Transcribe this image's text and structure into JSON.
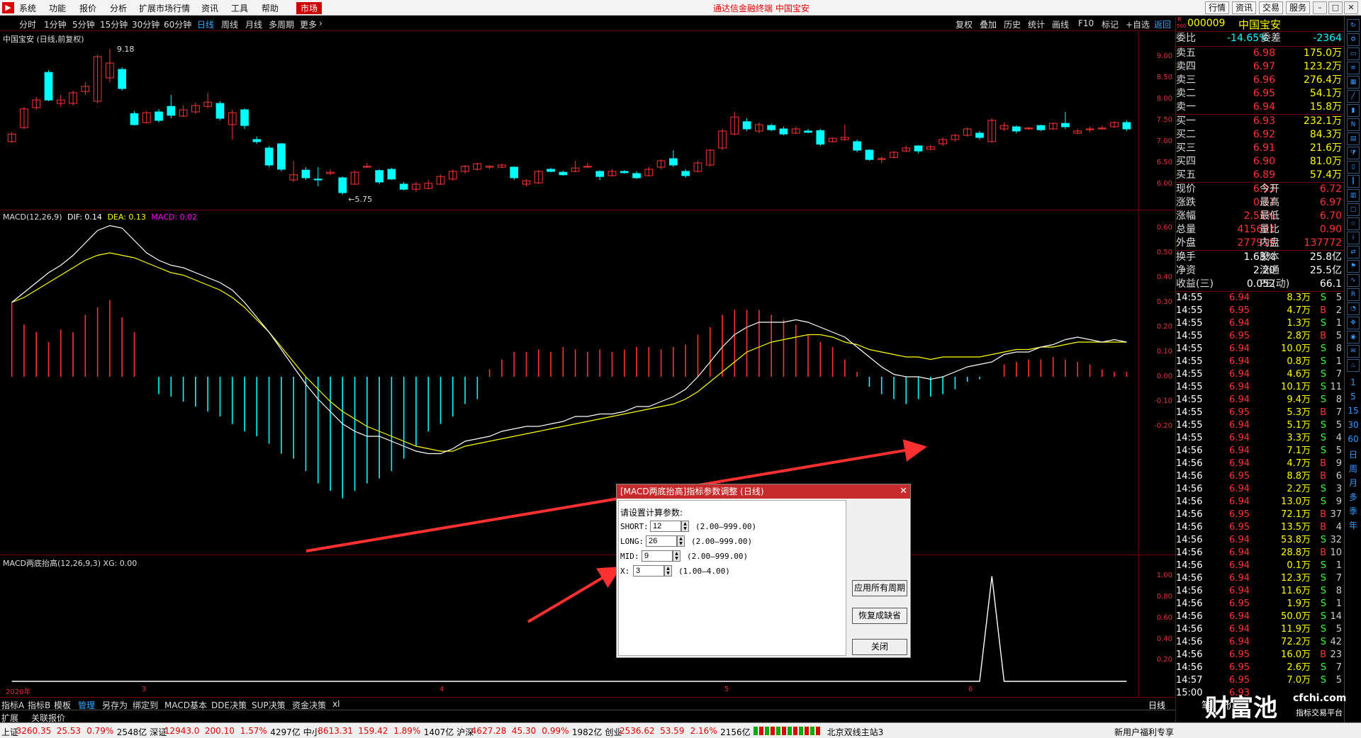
{
  "menubar": {
    "items": [
      "系统",
      "功能",
      "报价",
      "分析",
      "扩展市场行情",
      "资讯",
      "工具",
      "帮助"
    ],
    "market": "市场",
    "title": "通达信金融终端  中国宝安",
    "right_buttons": [
      "行情",
      "资讯",
      "交易",
      "服务"
    ]
  },
  "periods": [
    "分时",
    "1分钟",
    "5分钟",
    "15分钟",
    "30分钟",
    "60分钟",
    "日线",
    "周线",
    "月线",
    "多周期",
    "更多"
  ],
  "active_period": "日线",
  "chart_tools": [
    "复权",
    "叠加",
    "历史",
    "统计",
    "画线",
    "F10",
    "标记",
    "+自选",
    "返回"
  ],
  "main": {
    "title": "中国宝安 (日线,前复权)",
    "high_label": "9.18",
    "low_label": "5.75",
    "y_ticks": [
      "9.00",
      "8.50",
      "8.00",
      "7.50",
      "7.00",
      "6.50",
      "6.00"
    ]
  },
  "macd": {
    "name": "MACD(12,26,9)",
    "dif_label": "DIF: 0.14",
    "dea_label": "DEA: 0.13",
    "macd_label": "MACD: 0.02",
    "y_ticks": [
      "0.60",
      "0.50",
      "0.40",
      "0.30",
      "0.20",
      "0.10",
      "0.00",
      "-0.10",
      "-0.20"
    ]
  },
  "xg": {
    "title": "MACD两底抬高(12,26,9,3)  XG: 0.00",
    "y_ticks": [
      "1.00",
      "0.80",
      "0.60",
      "0.40",
      "0.20"
    ]
  },
  "x_labels": [
    "2020年",
    "3",
    "4",
    "5",
    "6"
  ],
  "bottom_tabs": [
    "指标A",
    "指标B",
    "模板",
    "管理",
    "另存为",
    "绑定到",
    "MACD基本",
    "DDE决策",
    "SUP决策",
    "资金决策",
    "xl"
  ],
  "active_tab": "管理",
  "sub_tabs": [
    "扩展",
    "关联报价"
  ],
  "period_badge": "日线",
  "dialog": {
    "title": "[MACD两底抬高]指标参数调整 (日线)",
    "prompt": "请设置计算参数:",
    "params": [
      {
        "name": "SHORT:",
        "value": "12",
        "range": "(2.00—999.00)"
      },
      {
        "name": "LONG:",
        "value": "26",
        "range": "(2.00—999.00)"
      },
      {
        "name": "MID:",
        "value": "9",
        "range": "(2.00—999.00)"
      },
      {
        "name": "X:",
        "value": "3",
        "range": "(1.00—4.00)"
      }
    ],
    "buttons": [
      "应用所有周期",
      "恢复成缺省",
      "关闭"
    ]
  },
  "quote": {
    "code": "000009",
    "name": "中国宝安",
    "badge_r": "R",
    "badge_num": "500",
    "weibi_label": "委比",
    "weibi": "-14.65%",
    "weicha_label": "委差",
    "weicha": "-2364",
    "sell": [
      {
        "label": "卖五",
        "price": "6.98",
        "vol": "175.0万"
      },
      {
        "label": "卖四",
        "price": "6.97",
        "vol": "123.2万"
      },
      {
        "label": "卖三",
        "price": "6.96",
        "vol": "276.4万"
      },
      {
        "label": "卖二",
        "price": "6.95",
        "vol": "54.1万"
      },
      {
        "label": "卖一",
        "price": "6.94",
        "vol": "15.8万"
      }
    ],
    "buy": [
      {
        "label": "买一",
        "price": "6.93",
        "vol": "232.1万"
      },
      {
        "label": "买二",
        "price": "6.92",
        "vol": "84.3万"
      },
      {
        "label": "买三",
        "price": "6.91",
        "vol": "21.6万"
      },
      {
        "label": "买四",
        "price": "6.90",
        "vol": "81.0万"
      },
      {
        "label": "买五",
        "price": "6.89",
        "vol": "57.4万"
      }
    ],
    "stats": [
      {
        "l1": "现价",
        "v1": "6.93",
        "l2": "今开",
        "v2": "6.72"
      },
      {
        "l1": "涨跌",
        "v1": "0.17",
        "l2": "最高",
        "v2": "6.97"
      },
      {
        "l1": "涨幅",
        "v1": "2.51%",
        "l2": "最低",
        "v2": "6.70"
      },
      {
        "l1": "总量",
        "v1": "415691",
        "l2": "量比",
        "v2": "0.90"
      },
      {
        "l1": "外盘",
        "v1": "277919",
        "l2": "内盘",
        "v2": "137772"
      }
    ],
    "stats2": [
      {
        "l1": "换手",
        "v1": "1.63%",
        "l2": "股本",
        "v2": "25.8亿"
      },
      {
        "l1": "净资",
        "v1": "2.20",
        "l2": "流通",
        "v2": "25.5亿"
      },
      {
        "l1": "收益(三)",
        "v1": "0.052",
        "l2": "PE(动)",
        "v2": "66.1"
      }
    ],
    "ticks": [
      [
        "14:55",
        "6.94",
        "8.3万",
        "S",
        "5"
      ],
      [
        "14:55",
        "6.95",
        "4.7万",
        "B",
        "2"
      ],
      [
        "14:55",
        "6.94",
        "1.3万",
        "S",
        "1"
      ],
      [
        "14:55",
        "6.95",
        "2.8万",
        "B",
        "5"
      ],
      [
        "14:55",
        "6.94",
        "10.0万",
        "S",
        "8"
      ],
      [
        "14:55",
        "6.94",
        "0.8万",
        "S",
        "1"
      ],
      [
        "14:55",
        "6.94",
        "4.6万",
        "S",
        "7"
      ],
      [
        "14:55",
        "6.94",
        "10.1万",
        "S",
        "11"
      ],
      [
        "14:55",
        "6.94",
        "9.4万",
        "S",
        "8"
      ],
      [
        "14:55",
        "6.95",
        "5.3万",
        "B",
        "7"
      ],
      [
        "14:55",
        "6.94",
        "5.1万",
        "S",
        "5"
      ],
      [
        "14:55",
        "6.94",
        "3.3万",
        "S",
        "4"
      ],
      [
        "14:56",
        "6.94",
        "7.1万",
        "S",
        "5"
      ],
      [
        "14:56",
        "6.94",
        "4.7万",
        "B",
        "9"
      ],
      [
        "14:56",
        "6.95",
        "8.8万",
        "B",
        "6"
      ],
      [
        "14:56",
        "6.94",
        "2.2万",
        "S",
        "3"
      ],
      [
        "14:56",
        "6.94",
        "13.0万",
        "S",
        "9"
      ],
      [
        "14:56",
        "6.95",
        "72.1万",
        "B",
        "37"
      ],
      [
        "14:56",
        "6.95",
        "13.5万",
        "B",
        "4"
      ],
      [
        "14:56",
        "6.94",
        "53.8万",
        "S",
        "32"
      ],
      [
        "14:56",
        "6.94",
        "28.8万",
        "B",
        "10"
      ],
      [
        "14:56",
        "6.94",
        "0.1万",
        "S",
        "1"
      ],
      [
        "14:56",
        "6.94",
        "12.3万",
        "S",
        "7"
      ],
      [
        "14:56",
        "6.94",
        "11.6万",
        "S",
        "8"
      ],
      [
        "14:56",
        "6.95",
        "1.9万",
        "S",
        "1"
      ],
      [
        "14:56",
        "6.94",
        "50.0万",
        "S",
        "14"
      ],
      [
        "14:56",
        "6.94",
        "11.9万",
        "S",
        "5"
      ],
      [
        "14:56",
        "6.94",
        "72.2万",
        "S",
        "42"
      ],
      [
        "14:56",
        "6.95",
        "16.0万",
        "B",
        "23"
      ],
      [
        "14:56",
        "6.95",
        "2.6万",
        "S",
        "7"
      ],
      [
        "14:57",
        "6.95",
        "7.0万",
        "S",
        "5"
      ],
      [
        "15:00",
        "6.93",
        "",
        "",
        ""
      ]
    ],
    "bottom_labels": [
      "笔",
      "价"
    ]
  },
  "right_icons": [
    "1",
    "5",
    "15",
    "30",
    "60",
    "日",
    "周",
    "月",
    "多",
    "季",
    "年"
  ],
  "watermark": {
    "logo": "财富池",
    "site": "cfchi.com",
    "slogan": "指标交易平台"
  },
  "status": {
    "items": [
      {
        "name": "上证",
        "val": "3260.35",
        "chg": "25.53",
        "pct": "0.79%",
        "amt": "2548亿"
      },
      {
        "name": "深证",
        "val": "12943.0",
        "chg": "200.10",
        "pct": "1.57%",
        "amt": "4297亿"
      },
      {
        "name": "中小",
        "val": "8613.31",
        "chg": "159.42",
        "pct": "1.89%",
        "amt": "1407亿"
      },
      {
        "name": "沪深",
        "val": "4627.28",
        "chg": "45.30",
        "pct": "0.99%",
        "amt": "1982亿"
      },
      {
        "name": "创业",
        "val": "2536.62",
        "chg": "53.59",
        "pct": "2.16%",
        "amt": "2156亿"
      }
    ],
    "server": "北京双线主站3",
    "promo": "新用户福利专享"
  },
  "colors": {
    "up": "#ff3333",
    "down": "#00ffff",
    "dif": "#ffffff",
    "dea": "#ffff00",
    "macd": "#ff00ff",
    "arrow": "#ff3030",
    "bg": "#000000",
    "grid": "#770000"
  },
  "chart_data": {
    "type": "candlestick",
    "candles": [
      [
        7.0,
        7.18,
        7.22,
        6.98
      ],
      [
        7.33,
        7.77,
        7.82,
        7.3
      ],
      [
        7.8,
        7.98,
        8.05,
        7.75
      ],
      [
        8.63,
        7.98,
        8.68,
        7.95
      ],
      [
        7.9,
        7.98,
        8.1,
        7.82
      ],
      [
        7.9,
        8.15,
        8.2,
        7.85
      ],
      [
        8.18,
        8.3,
        8.4,
        8.1
      ],
      [
        7.95,
        9.0,
        9.05,
        7.9
      ],
      [
        8.5,
        8.85,
        9.18,
        8.4
      ],
      [
        8.7,
        8.25,
        8.75,
        8.2
      ],
      [
        7.66,
        7.4,
        7.72,
        7.38
      ],
      [
        7.45,
        7.68,
        7.72,
        7.42
      ],
      [
        7.7,
        7.5,
        7.77,
        7.45
      ],
      [
        7.83,
        7.62,
        8.1,
        7.55
      ],
      [
        7.6,
        7.75,
        7.85,
        7.58
      ],
      [
        7.7,
        7.85,
        7.92,
        7.65
      ],
      [
        7.83,
        7.93,
        8.15,
        7.78
      ],
      [
        7.9,
        7.55,
        7.95,
        7.5
      ],
      [
        7.4,
        7.68,
        7.75,
        7.05
      ],
      [
        7.75,
        7.38,
        7.78,
        7.3
      ],
      [
        7.05,
        7.0,
        7.12,
        6.95
      ],
      [
        6.85,
        6.45,
        6.9,
        6.4
      ],
      [
        6.95,
        6.35,
        6.97,
        6.3
      ],
      [
        6.1,
        6.22,
        6.55,
        6.05
      ],
      [
        6.33,
        6.15,
        6.4,
        6.1
      ],
      [
        6.12,
        6.1,
        6.4,
        5.95
      ],
      [
        6.25,
        6.28,
        6.35,
        6.22
      ],
      [
        6.15,
        5.8,
        6.18,
        5.75
      ],
      [
        6.0,
        6.28,
        6.32,
        5.98
      ],
      [
        6.4,
        6.42,
        6.5,
        6.38
      ],
      [
        6.32,
        6.05,
        6.35,
        6.0
      ],
      [
        6.35,
        6.12,
        6.38,
        6.1
      ],
      [
        6.0,
        5.88,
        6.05,
        5.85
      ],
      [
        5.88,
        6.0,
        6.05,
        5.82
      ],
      [
        5.9,
        6.02,
        6.1,
        5.88
      ],
      [
        6.0,
        6.18,
        6.22,
        5.98
      ],
      [
        6.12,
        6.3,
        6.35,
        6.08
      ],
      [
        6.3,
        6.42,
        6.45,
        6.25
      ],
      [
        6.35,
        6.48,
        6.5,
        6.32
      ],
      [
        6.4,
        6.42,
        6.45,
        6.35
      ],
      [
        6.4,
        6.45,
        6.48,
        6.38
      ],
      [
        6.4,
        6.15,
        6.42,
        6.1
      ],
      [
        6.0,
        6.08,
        6.12,
        5.95
      ],
      [
        6.03,
        6.3,
        6.33,
        6.0
      ],
      [
        6.35,
        6.3,
        6.38,
        6.28
      ],
      [
        6.28,
        6.22,
        6.32,
        6.2
      ],
      [
        6.3,
        6.38,
        6.55,
        6.28
      ],
      [
        6.4,
        6.42,
        6.5,
        6.38
      ],
      [
        6.3,
        6.18,
        6.33,
        6.1
      ],
      [
        6.2,
        6.3,
        6.35,
        6.18
      ],
      [
        6.3,
        6.27,
        6.33,
        6.25
      ],
      [
        6.25,
        6.15,
        6.3,
        6.12
      ],
      [
        6.2,
        6.35,
        6.4,
        6.18
      ],
      [
        6.4,
        6.55,
        6.58,
        6.35
      ],
      [
        6.6,
        6.45,
        6.8,
        6.4
      ],
      [
        6.3,
        6.2,
        6.35,
        6.15
      ],
      [
        6.3,
        6.5,
        6.55,
        6.28
      ],
      [
        6.45,
        6.8,
        6.82,
        6.42
      ],
      [
        6.85,
        7.25,
        7.3,
        6.8
      ],
      [
        7.18,
        7.58,
        7.7,
        7.15
      ],
      [
        7.47,
        7.3,
        7.55,
        7.25
      ],
      [
        7.25,
        7.4,
        7.45,
        7.2
      ],
      [
        7.38,
        7.28,
        7.42,
        7.25
      ],
      [
        7.3,
        7.18,
        7.35,
        7.15
      ],
      [
        7.2,
        7.3,
        7.35,
        7.18
      ],
      [
        7.25,
        7.22,
        7.3,
        7.2
      ],
      [
        7.26,
        6.94,
        7.3,
        6.9
      ],
      [
        7.0,
        7.08,
        7.1,
        6.98
      ],
      [
        7.05,
        7.1,
        7.4,
        7.02
      ],
      [
        7.0,
        6.8,
        7.05,
        6.75
      ],
      [
        6.8,
        6.58,
        6.82,
        6.55
      ],
      [
        6.6,
        6.6,
        6.65,
        6.5
      ],
      [
        6.63,
        6.75,
        6.78,
        6.6
      ],
      [
        6.78,
        6.85,
        6.9,
        6.75
      ],
      [
        6.9,
        6.78,
        6.92,
        6.72
      ],
      [
        6.82,
        6.88,
        6.92,
        6.8
      ],
      [
        6.95,
        7.05,
        7.1,
        6.9
      ],
      [
        7.05,
        7.15,
        7.18,
        7.0
      ],
      [
        7.15,
        7.3,
        7.33,
        7.12
      ],
      [
        7.2,
        7.1,
        7.25,
        7.05
      ],
      [
        7.0,
        7.5,
        7.55,
        6.98
      ],
      [
        7.3,
        7.38,
        7.45,
        7.25
      ],
      [
        7.35,
        7.25,
        7.38,
        7.2
      ],
      [
        7.3,
        7.32,
        7.35,
        7.28
      ],
      [
        7.38,
        7.28,
        7.4,
        7.25
      ],
      [
        7.3,
        7.43,
        7.45,
        7.28
      ],
      [
        7.43,
        7.35,
        7.7,
        7.3
      ],
      [
        7.2,
        7.25,
        7.3,
        7.18
      ],
      [
        7.28,
        7.3,
        7.35,
        7.22
      ],
      [
        7.3,
        7.32,
        7.38,
        7.28
      ],
      [
        7.35,
        7.45,
        7.48,
        7.32
      ],
      [
        7.45,
        7.3,
        7.5,
        7.25
      ]
    ],
    "macd_bars": [
      0.3,
      0.21,
      0.18,
      0.14,
      0.19,
      0.18,
      0.25,
      0.28,
      0.31,
      0.24,
      0.18,
      0.0,
      -0.07,
      -0.08,
      -0.1,
      -0.12,
      -0.14,
      -0.16,
      -0.19,
      -0.22,
      -0.24,
      -0.27,
      -0.31,
      -0.33,
      -0.38,
      -0.43,
      -0.46,
      -0.49,
      -0.46,
      -0.43,
      -0.41,
      -0.38,
      -0.33,
      -0.28,
      -0.22,
      -0.19,
      -0.16,
      -0.11,
      -0.09,
      0.03,
      0.07,
      0.1,
      0.1,
      0.11,
      0.1,
      0.12,
      0.11,
      0.1,
      0.11,
      0.1,
      0.11,
      0.12,
      0.12,
      0.11,
      0.12,
      0.13,
      0.17,
      0.2,
      0.25,
      0.27,
      0.27,
      0.27,
      0.25,
      0.23,
      0.21,
      0.17,
      0.14,
      0.12,
      0.07,
      0.02,
      -0.04,
      -0.07,
      -0.09,
      -0.11,
      -0.09,
      -0.08,
      -0.07,
      -0.05,
      -0.02,
      -0.01,
      0.0,
      0.05,
      0.06,
      0.07,
      0.07,
      0.08,
      0.07,
      0.06,
      0.05,
      0.03,
      0.02,
      0.02
    ],
    "dif": [
      0.3,
      0.34,
      0.38,
      0.42,
      0.45,
      0.49,
      0.54,
      0.59,
      0.61,
      0.6,
      0.55,
      0.5,
      0.47,
      0.45,
      0.44,
      0.42,
      0.4,
      0.38,
      0.35,
      0.3,
      0.24,
      0.18,
      0.11,
      0.04,
      -0.03,
      -0.09,
      -0.14,
      -0.19,
      -0.22,
      -0.24,
      -0.24,
      -0.26,
      -0.28,
      -0.3,
      -0.31,
      -0.31,
      -0.29,
      -0.26,
      -0.25,
      -0.24,
      -0.22,
      -0.21,
      -0.2,
      -0.2,
      -0.19,
      -0.18,
      -0.16,
      -0.16,
      -0.15,
      -0.15,
      -0.14,
      -0.12,
      -0.12,
      -0.1,
      -0.08,
      -0.05,
      0.0,
      0.06,
      0.12,
      0.17,
      0.2,
      0.22,
      0.22,
      0.22,
      0.23,
      0.22,
      0.2,
      0.18,
      0.16,
      0.12,
      0.08,
      0.04,
      0.01,
      0.0,
      0.0,
      -0.01,
      0.0,
      0.02,
      0.04,
      0.05,
      0.06,
      0.09,
      0.1,
      0.1,
      0.12,
      0.13,
      0.15,
      0.16,
      0.15,
      0.14,
      0.15,
      0.14
    ],
    "dea": [
      0.3,
      0.32,
      0.35,
      0.38,
      0.41,
      0.44,
      0.47,
      0.49,
      0.5,
      0.49,
      0.48,
      0.46,
      0.44,
      0.42,
      0.41,
      0.39,
      0.37,
      0.35,
      0.32,
      0.28,
      0.23,
      0.18,
      0.12,
      0.06,
      0.0,
      -0.05,
      -0.1,
      -0.14,
      -0.17,
      -0.2,
      -0.22,
      -0.24,
      -0.26,
      -0.28,
      -0.29,
      -0.3,
      -0.3,
      -0.28,
      -0.27,
      -0.26,
      -0.25,
      -0.24,
      -0.23,
      -0.22,
      -0.21,
      -0.2,
      -0.19,
      -0.18,
      -0.17,
      -0.16,
      -0.15,
      -0.14,
      -0.13,
      -0.12,
      -0.11,
      -0.09,
      -0.06,
      -0.02,
      0.02,
      0.06,
      0.1,
      0.12,
      0.14,
      0.15,
      0.16,
      0.17,
      0.17,
      0.16,
      0.14,
      0.13,
      0.11,
      0.1,
      0.09,
      0.08,
      0.08,
      0.07,
      0.08,
      0.08,
      0.08,
      0.08,
      0.09,
      0.1,
      0.11,
      0.11,
      0.12,
      0.12,
      0.13,
      0.14,
      0.14,
      0.14,
      0.14,
      0.14
    ],
    "xg": [
      0,
      0,
      0,
      0,
      0,
      0,
      0,
      0,
      0,
      0,
      0,
      0,
      0,
      0,
      0,
      0,
      0,
      0,
      0,
      0,
      0,
      0,
      0,
      0,
      0,
      0,
      0,
      0,
      0,
      0,
      0,
      0,
      0,
      0,
      0,
      0,
      0,
      0,
      0,
      0,
      0,
      0,
      0,
      0,
      0,
      0,
      0,
      0,
      0,
      0,
      0,
      0,
      0,
      0,
      0,
      0,
      0,
      0,
      0,
      0,
      0,
      0,
      0,
      0,
      0,
      0,
      0,
      0,
      0,
      0,
      0,
      0,
      0,
      0,
      0,
      0,
      0,
      0,
      0,
      0,
      1,
      0,
      0,
      0,
      0,
      0,
      0,
      0,
      0,
      0,
      0,
      0
    ],
    "price_ylim": [
      5.6,
      9.4
    ],
    "macd_ylim": [
      -0.5,
      0.62
    ],
    "xg_ylim": [
      0,
      1.05
    ]
  }
}
